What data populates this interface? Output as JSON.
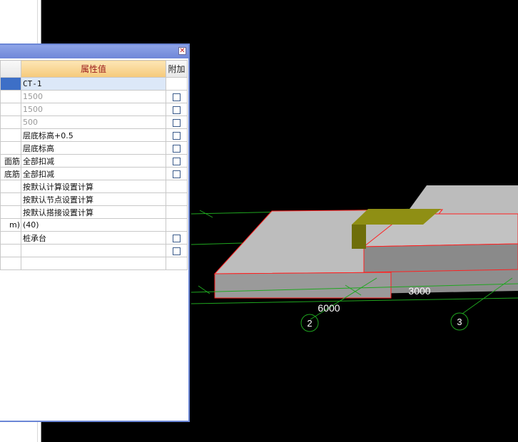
{
  "panel": {
    "close_symbol": "✕",
    "headers": {
      "name": "",
      "value": "属性值",
      "add": "附加"
    },
    "rows": [
      {
        "name": "",
        "value": "CT-1",
        "gray": false,
        "checkbox": false,
        "selected": true
      },
      {
        "name": "",
        "value": "1500",
        "gray": true,
        "checkbox": true
      },
      {
        "name": "",
        "value": "1500",
        "gray": true,
        "checkbox": true
      },
      {
        "name": "",
        "value": "500",
        "gray": true,
        "checkbox": true
      },
      {
        "name": "",
        "value": "层底标高+0.5",
        "gray": false,
        "checkbox": true
      },
      {
        "name": "",
        "value": "层底标高",
        "gray": false,
        "checkbox": true
      },
      {
        "name": "面筋",
        "value": "全部扣减",
        "gray": false,
        "checkbox": true
      },
      {
        "name": "底筋",
        "value": "全部扣减",
        "gray": false,
        "checkbox": true
      },
      {
        "name": "",
        "value": "按默认计算设置计算",
        "gray": false,
        "checkbox": false
      },
      {
        "name": "",
        "value": "按默认节点设置计算",
        "gray": false,
        "checkbox": false
      },
      {
        "name": "",
        "value": "按默认搭接设置计算",
        "gray": false,
        "checkbox": false
      },
      {
        "name": "m)",
        "value": "(40)",
        "gray": false,
        "checkbox": false
      },
      {
        "name": "",
        "value": "桩承台",
        "gray": false,
        "checkbox": true
      },
      {
        "name": "",
        "value": "",
        "gray": false,
        "checkbox": true
      },
      {
        "name": "",
        "value": "",
        "gray": false,
        "checkbox": false
      }
    ]
  },
  "viewport": {
    "dimension_labels": [
      "6000",
      "3000"
    ],
    "axis_labels": [
      "2",
      "3"
    ],
    "colors": {
      "slab": "#b4b4b4",
      "slab_dark": "#8c8c8c",
      "column": "#7c7c0a",
      "grid": "#1fa61f",
      "edge": "#ff2020"
    }
  }
}
